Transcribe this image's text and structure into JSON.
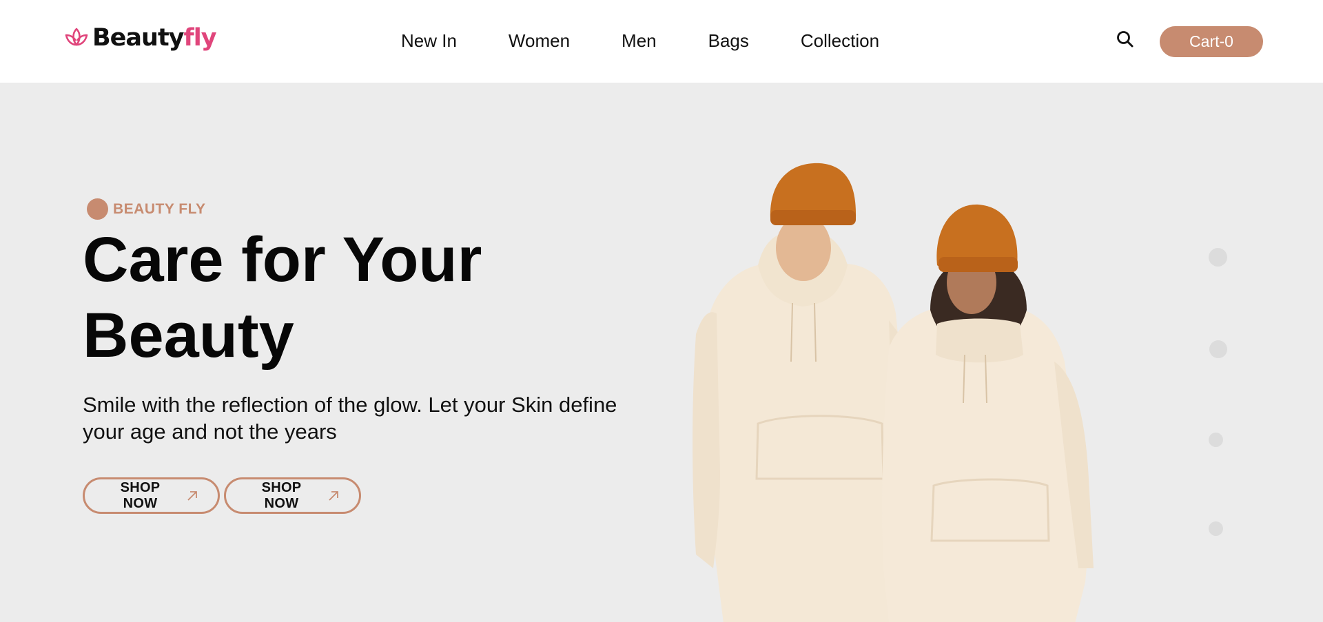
{
  "brand": {
    "name_part1": "Beauty",
    "name_part2": "fly",
    "accent": "#e0457b"
  },
  "nav": {
    "items": [
      {
        "label": "New In"
      },
      {
        "label": "Women"
      },
      {
        "label": "Men"
      },
      {
        "label": "Bags"
      },
      {
        "label": "Collection"
      }
    ]
  },
  "header": {
    "search_icon": "search-icon",
    "cart_label": "Cart-0"
  },
  "hero": {
    "eyebrow": "BEAUTY FLY",
    "title_line1": "Care for Your",
    "title_line2": "Beauty",
    "subtitle_line1": "Smile with the reflection of the glow. Let your Skin define",
    "subtitle_line2": "your age and not the years",
    "buttons": [
      {
        "label": "SHOP NOW",
        "icon": "arrow-up-right-icon"
      },
      {
        "label": "SHOP NOW",
        "icon": "arrow-up-right-icon"
      }
    ],
    "image": "two models wearing cream hoodies and orange beanies"
  },
  "slider": {
    "dot_count": 4
  },
  "colors": {
    "accent": "#c78b70",
    "background": "#ececec",
    "header_bg": "#ffffff",
    "brand_pink": "#e0457b"
  }
}
